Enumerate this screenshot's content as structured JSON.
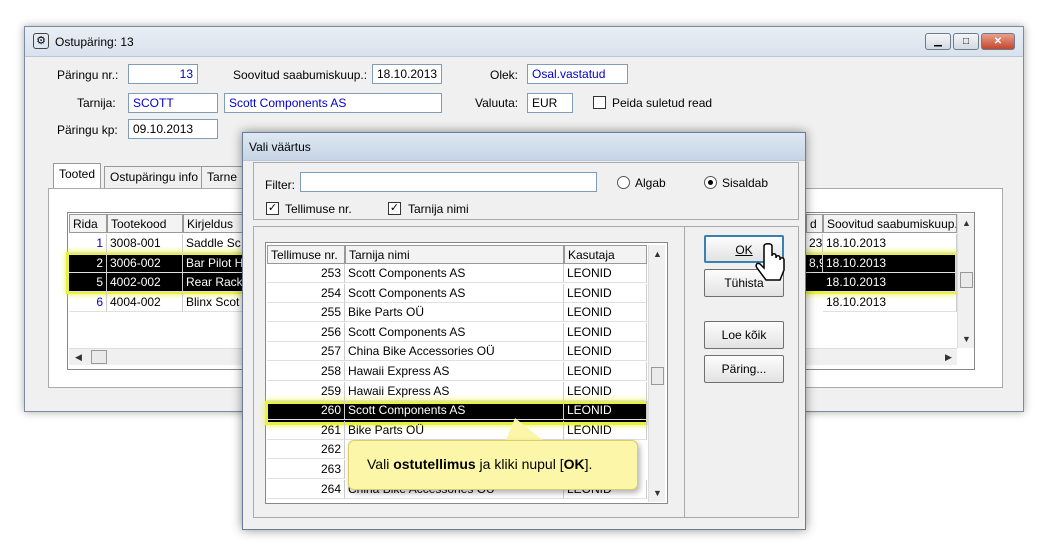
{
  "main": {
    "title": "Ostupäring: 13",
    "labels": {
      "request_no": "Päringu nr.:",
      "agreed_arrival": "Soovitud saabumiskuup.:",
      "status": "Olek:",
      "supplier": "Tarnija:",
      "currency": "Valuuta:",
      "hide_closed": "Peida suletud read",
      "request_date": "Päringu kp:"
    },
    "values": {
      "request_no": "13",
      "agreed_arrival": "18.10.2013",
      "status": "Osal.vastatud",
      "supplier_code": "SCOTT",
      "supplier_name": "Scott Components AS",
      "currency": "EUR",
      "request_date": "09.10.2013"
    },
    "tabs": [
      "Tooted",
      "Ostupäringu info",
      "Tarne"
    ],
    "grid": {
      "headers": [
        "Rida",
        "Tootekood",
        "Kirjeldus",
        "d",
        "Soovitud saabumiskuup."
      ],
      "rows": [
        {
          "rida": "1",
          "code": "3008-001",
          "desc": "Saddle Sc",
          "d": "23",
          "date": "18.10.2013"
        },
        {
          "rida": "2",
          "code": "3006-002",
          "desc": "Bar Pilot H",
          "d": "8,9",
          "date": "18.10.2013"
        },
        {
          "rida": "5",
          "code": "4002-002",
          "desc": "Rear Rack",
          "d": "",
          "date": "18.10.2013"
        },
        {
          "rida": "6",
          "code": "4004-002",
          "desc": "Blinx Scot",
          "d": "",
          "date": "18.10.2013"
        }
      ]
    }
  },
  "dialog": {
    "title": "Vali väärtus",
    "filter_label": "Filter:",
    "filter_value": "",
    "radio_starts": "Algab",
    "radio_contains": "Sisaldab",
    "check_order": "Tellimuse nr.",
    "check_supplier": "Tarnija nimi",
    "headers": [
      "Tellimuse nr.",
      "Tarnija nimi",
      "Kasutaja"
    ],
    "rows": [
      {
        "no": "253",
        "supplier": "Scott Components AS",
        "user": "LEONID"
      },
      {
        "no": "254",
        "supplier": "Scott Components AS",
        "user": "LEONID"
      },
      {
        "no": "255",
        "supplier": "Bike Parts OÜ",
        "user": "LEONID"
      },
      {
        "no": "256",
        "supplier": "Scott Components AS",
        "user": "LEONID"
      },
      {
        "no": "257",
        "supplier": "China Bike Accessories OÜ",
        "user": "LEONID"
      },
      {
        "no": "258",
        "supplier": "Hawaii Express AS",
        "user": "LEONID"
      },
      {
        "no": "259",
        "supplier": "Hawaii Express AS",
        "user": "LEONID"
      },
      {
        "no": "260",
        "supplier": "Scott Components AS",
        "user": "LEONID"
      },
      {
        "no": "261",
        "supplier": "Bike Parts OÜ",
        "user": "LEONID"
      },
      {
        "no": "262",
        "supplier": "",
        "user": ""
      },
      {
        "no": "263",
        "supplier": "",
        "user": ""
      },
      {
        "no": "264",
        "supplier": "China Bike Accessories OÜ",
        "user": "LEONID"
      }
    ],
    "buttons": {
      "ok": "OK",
      "cancel": "Tühista",
      "read_all": "Loe kõik",
      "query": "Päring..."
    }
  },
  "callout": {
    "pre": "Vali ",
    "bold1": "ostutellimus",
    "mid": " ja kliki nupul [",
    "bold2": "OK",
    "post": "]."
  }
}
